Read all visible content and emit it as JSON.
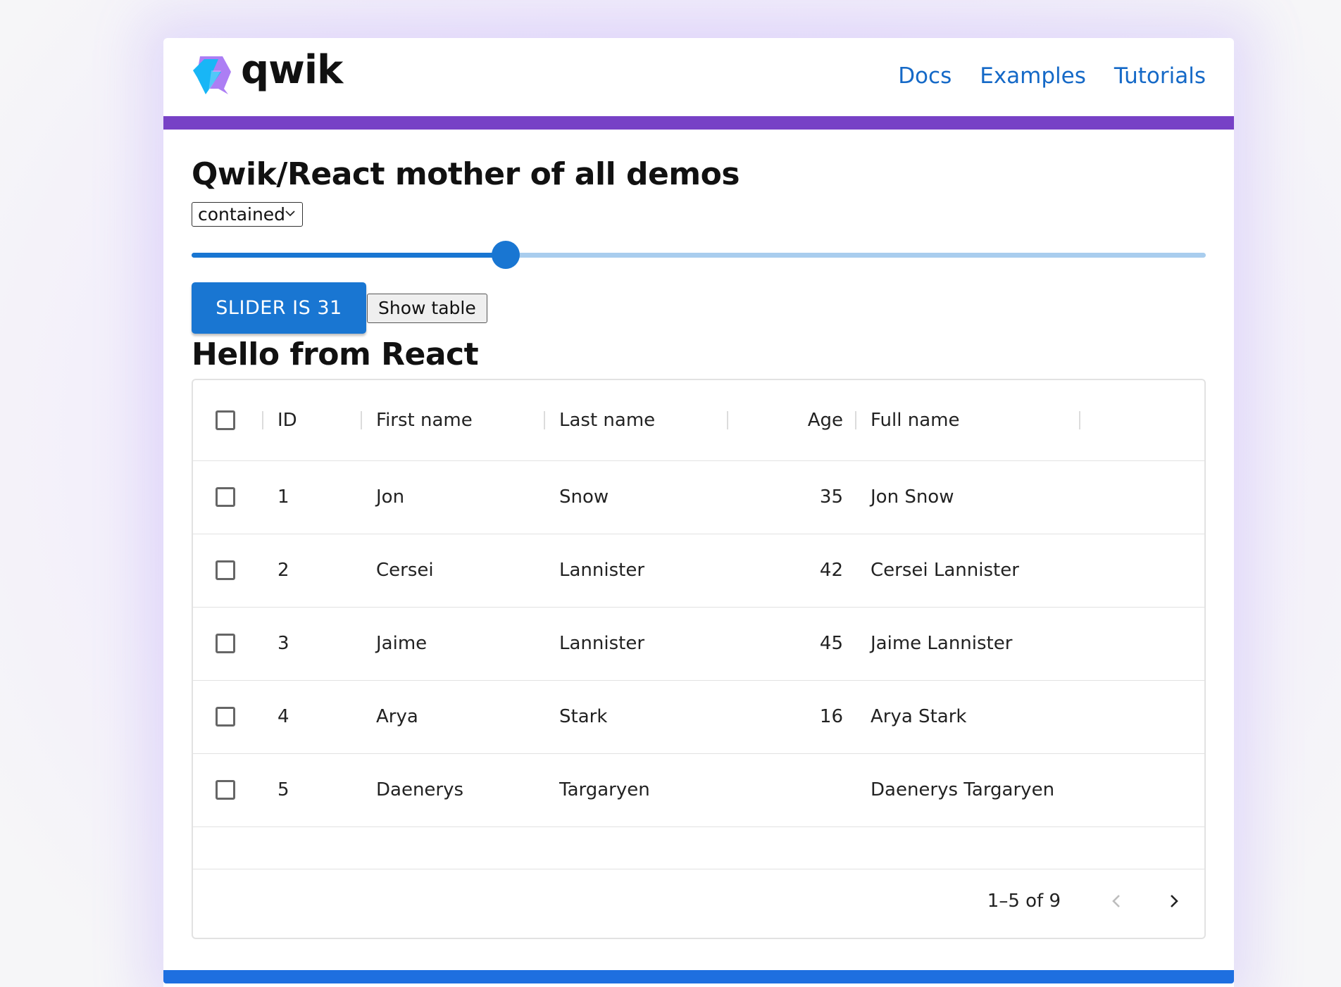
{
  "header": {
    "logo_text": "qwik",
    "nav": [
      {
        "label": "Docs"
      },
      {
        "label": "Examples"
      },
      {
        "label": "Tutorials"
      }
    ]
  },
  "main": {
    "title": "Qwik/React mother of all demos",
    "select": {
      "value": "contained"
    },
    "slider": {
      "value": 31,
      "min": 0,
      "max": 100
    },
    "primary_button_label": "SLIDER IS 31",
    "secondary_button_label": "Show table",
    "section_title": "Hello from React"
  },
  "grid": {
    "columns": [
      "ID",
      "First name",
      "Last name",
      "Age",
      "Full name"
    ],
    "rows": [
      {
        "id": "1",
        "first": "Jon",
        "last": "Snow",
        "age": "35",
        "full": "Jon Snow"
      },
      {
        "id": "2",
        "first": "Cersei",
        "last": "Lannister",
        "age": "42",
        "full": "Cersei Lannister"
      },
      {
        "id": "3",
        "first": "Jaime",
        "last": "Lannister",
        "age": "45",
        "full": "Jaime Lannister"
      },
      {
        "id": "4",
        "first": "Arya",
        "last": "Stark",
        "age": "16",
        "full": "Arya Stark"
      },
      {
        "id": "5",
        "first": "Daenerys",
        "last": "Targaryen",
        "age": "",
        "full": "Daenerys Targaryen"
      }
    ],
    "pagination": {
      "label": "1–5 of 9"
    }
  },
  "colors": {
    "accent_purple": "#7741c6",
    "accent_blue": "#1976d2",
    "link_blue": "#1569c7",
    "bottom_bar": "#1e6fe0"
  },
  "icons": {
    "logo": "qwik-logo-icon",
    "select": "chevron-down-icon",
    "prev": "chevron-left-icon",
    "next": "chevron-right-icon"
  }
}
